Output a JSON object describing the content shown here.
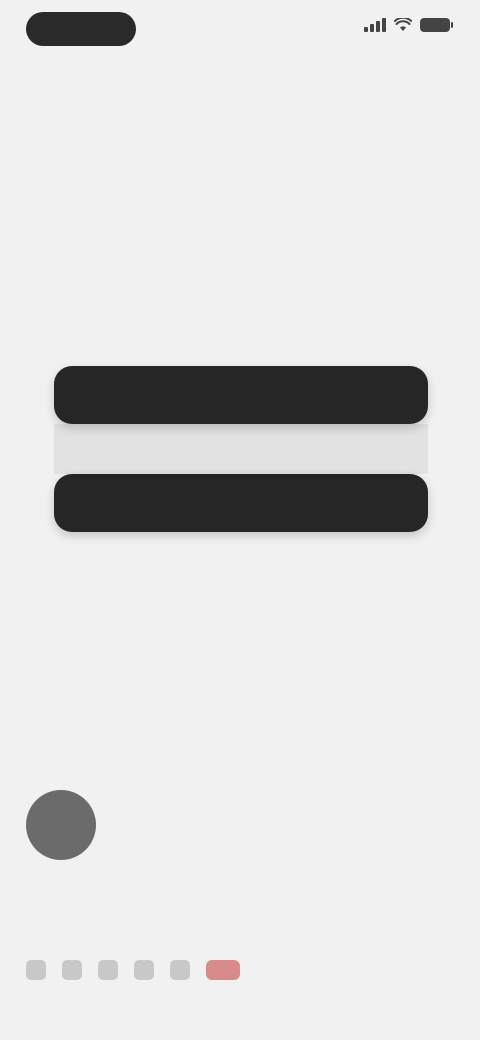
{
  "status_bar": {
    "time": "",
    "icons": [
      "signal-icon",
      "wifi-icon",
      "battery-icon"
    ]
  },
  "main": {
    "prompt": "",
    "buttons": [
      {
        "label": ""
      },
      {
        "label": ""
      }
    ]
  },
  "profile": {
    "name": "",
    "bio": "",
    "social_icons": [
      "link-icon-1",
      "link-icon-2",
      "link-icon-3",
      "link-icon-4",
      "link-icon-5",
      "link-icon-accent"
    ]
  },
  "colors": {
    "background": "#f1f1f1",
    "button": "#262626",
    "accent": "#d98b8b"
  }
}
